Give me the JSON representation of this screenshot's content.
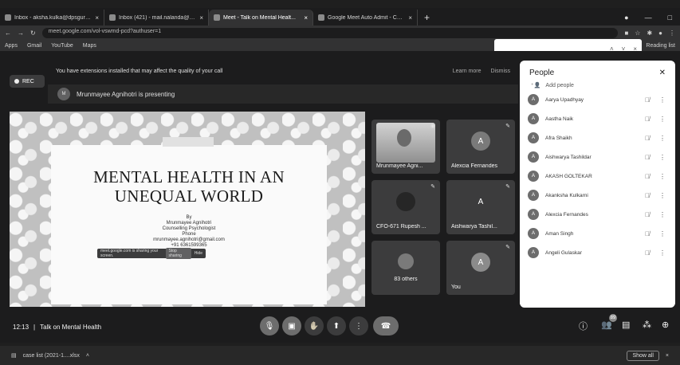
{
  "browser": {
    "tabs": [
      {
        "label": "Inbox - aksha.kulka@dpsgurgaon...",
        "active": false
      },
      {
        "label": "Inbox (421) - mail.nalanda@gm...",
        "active": false
      },
      {
        "label": "Meet - Talk on Mental Healt...",
        "active": true
      },
      {
        "label": "Google Meet Auto Admit - Chr...",
        "active": false
      }
    ],
    "new_tab": "+",
    "url": "meet.google.com/vol-vswmd-pcd?authuser=1",
    "bookmarks": [
      "Apps",
      "Gmail",
      "YouTube",
      "Maps"
    ],
    "bookmarks_right": "Reading list"
  },
  "meet": {
    "extension_banner": "You have extensions installed that may affect the quality of your call",
    "banner_learn_more": "Learn more",
    "banner_dismiss": "Dismiss",
    "rec_label": "REC",
    "presenter_initials": "M",
    "presenting_text": "Mrunmayee Agnihotri is presenting",
    "slide": {
      "title": "MENTAL HEALTH IN AN UNEQUAL WORLD",
      "by": "By",
      "presenter": "Mrunmayee Agnihotri",
      "role": "Counselling Psychologist",
      "phone_label": "Phone",
      "email": "mrunmayee.agnihotri@gmail.com",
      "phone": "+91 6361599365",
      "sharing_text": "meet.google.com is sharing your screen.",
      "stop_sharing": "Stop sharing",
      "hide": "Hide"
    },
    "tiles": [
      {
        "name": "Mrunmayee Agni...",
        "initial": ""
      },
      {
        "name": "Alexcia Fernandes",
        "initial": "A"
      },
      {
        "name": "CFO-671 Rupesh ...",
        "initial": ""
      },
      {
        "name": "Aishwarya Tashil...",
        "initial": "A"
      },
      {
        "name": "83 others",
        "initial": ""
      },
      {
        "name": "You",
        "initial": "A"
      }
    ],
    "meeting_time": "12:13",
    "meeting_separator": "|",
    "meeting_title": "Talk on Mental Health",
    "people_badge": "89"
  },
  "people": {
    "title": "People",
    "add_people": "Add people",
    "list": [
      {
        "name": "Aarya Upadhyay",
        "initial": "A"
      },
      {
        "name": "Aastha Naik",
        "initial": "A"
      },
      {
        "name": "Afra Shaikh",
        "initial": "A"
      },
      {
        "name": "Aishwarya Tashildar",
        "initial": "A"
      },
      {
        "name": "AKASH GOLTEKAR",
        "initial": "A"
      },
      {
        "name": "Akanksha Kulkarni",
        "initial": "A"
      },
      {
        "name": "Alexcia Fernandes",
        "initial": "A"
      },
      {
        "name": "Aman Singh",
        "initial": "A"
      },
      {
        "name": "Angeli Gulaskar",
        "initial": "A"
      }
    ]
  },
  "downloads": {
    "file": "case list (2021-1....xlsx",
    "show_all": "Show all"
  }
}
